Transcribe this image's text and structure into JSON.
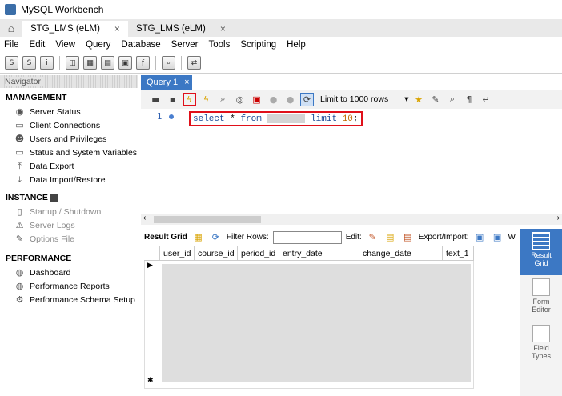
{
  "window": {
    "title": "MySQL Workbench"
  },
  "connection_tabs": [
    {
      "label": "STG_LMS (eLM)",
      "close": "×"
    },
    {
      "label": "STG_LMS (eLM)",
      "close": "×"
    }
  ],
  "menu": [
    "File",
    "Edit",
    "View",
    "Query",
    "Database",
    "Server",
    "Tools",
    "Scripting",
    "Help"
  ],
  "navigator": {
    "header": "Navigator",
    "management": {
      "title": "MANAGEMENT",
      "items": [
        "Server Status",
        "Client Connections",
        "Users and Privileges",
        "Status and System Variables",
        "Data Export",
        "Data Import/Restore"
      ]
    },
    "instance": {
      "title": "INSTANCE",
      "items": [
        "Startup / Shutdown",
        "Server Logs",
        "Options File"
      ]
    },
    "performance": {
      "title": "PERFORMANCE",
      "items": [
        "Dashboard",
        "Performance Reports",
        "Performance Schema Setup"
      ]
    }
  },
  "query_tab": {
    "label": "Query 1",
    "close": "×"
  },
  "query_toolbar": {
    "limit_label": "Limit to 1000 rows",
    "dropdown": "▾"
  },
  "editor": {
    "line_number": "1",
    "kw_select": "select",
    "star": "*",
    "kw_from": "from",
    "kw_limit": "limit",
    "limit_value": "10",
    "semicolon": ";"
  },
  "result_toolbar": {
    "result_grid": "Result Grid",
    "filter_rows": "Filter Rows:",
    "edit": "Edit:",
    "export_import": "Export/Import:",
    "wrap": "W"
  },
  "grid": {
    "columns": [
      "user_id",
      "course_id",
      "period_id",
      "entry_date",
      "change_date",
      "text_1"
    ]
  },
  "side_panel": {
    "buttons": [
      "Result Grid",
      "Form Editor",
      "Field Types"
    ]
  }
}
